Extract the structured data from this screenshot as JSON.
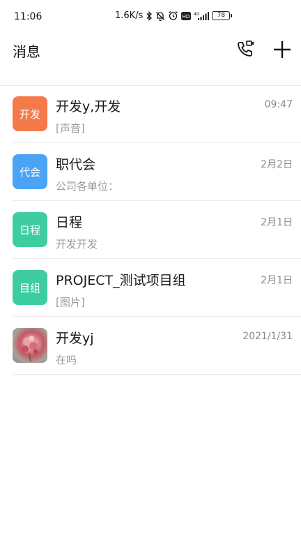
{
  "status_bar": {
    "time": "11:06",
    "network_speed": "1.6K/s",
    "hd_badge": "HD",
    "network_type": "4G",
    "battery": "78"
  },
  "header": {
    "title": "消息"
  },
  "conversations": [
    {
      "avatar_text": "开发",
      "avatar_color": "#F6794A",
      "title": "开发y,开发",
      "time": "09:47",
      "preview": "[声音]"
    },
    {
      "avatar_text": "代会",
      "avatar_color": "#4AA3F4",
      "title": "职代会",
      "time": "2月2日",
      "preview": "公司各单位："
    },
    {
      "avatar_text": "日程",
      "avatar_color": "#3ECDA0",
      "title": "日程",
      "time": "2月1日",
      "preview": "开发开发"
    },
    {
      "avatar_text": "目组",
      "avatar_color": "#3ECDA0",
      "title": "PROJECT_测试项目组",
      "time": "2月1日",
      "preview": "[图片]"
    },
    {
      "avatar_text": "",
      "avatar_color": "",
      "title": "开发yj",
      "time": "2021/1/31",
      "preview": "在吗"
    }
  ]
}
